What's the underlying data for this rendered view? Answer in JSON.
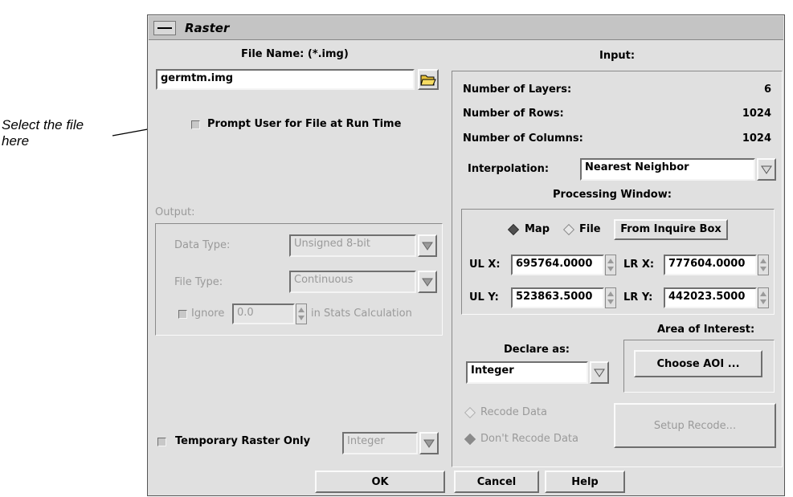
{
  "annotation": {
    "line1": "Select the file",
    "line2": "here"
  },
  "window": {
    "title": "Raster"
  },
  "left": {
    "file_name_label": "File Name: (*.img)",
    "file_value": "germtm.img",
    "prompt_user_label": "Prompt User for File at Run Time",
    "output_label": "Output:",
    "data_type_label": "Data Type:",
    "data_type_value": "Unsigned 8-bit",
    "file_type_label": "File Type:",
    "file_type_value": "Continuous",
    "ignore_label": "Ignore",
    "ignore_value": "0.0",
    "stats_label": "in Stats Calculation",
    "temporary_label": "Temporary Raster Only",
    "temporary_type_value": "Integer"
  },
  "input": {
    "title": "Input:",
    "layers_label": "Number of Layers:",
    "layers_value": "6",
    "rows_label": "Number of Rows:",
    "rows_value": "1024",
    "cols_label": "Number of Columns:",
    "cols_value": "1024",
    "interp_label": "Interpolation:",
    "interp_value": "Nearest Neighbor",
    "proc_window_label": "Processing Window:",
    "map_label": "Map",
    "file_label": "File",
    "inquire_box_button": "From Inquire Box",
    "ulx_label": "UL X:",
    "ulx_value": "695764.0000",
    "lrx_label": "LR X:",
    "lrx_value": "777604.0000",
    "uly_label": "UL Y:",
    "uly_value": "523863.5000",
    "lry_label": "LR Y:",
    "lry_value": "442023.5000",
    "aoi_label": "Area of Interest:",
    "declare_label": "Declare as:",
    "declare_value": "Integer",
    "choose_aoi_button": "Choose AOI ...",
    "recode_label": "Recode Data",
    "dont_recode_label": "Don't Recode Data",
    "setup_recode_button": "Setup Recode..."
  },
  "buttons": {
    "ok": "OK",
    "cancel": "Cancel",
    "help": "Help"
  }
}
